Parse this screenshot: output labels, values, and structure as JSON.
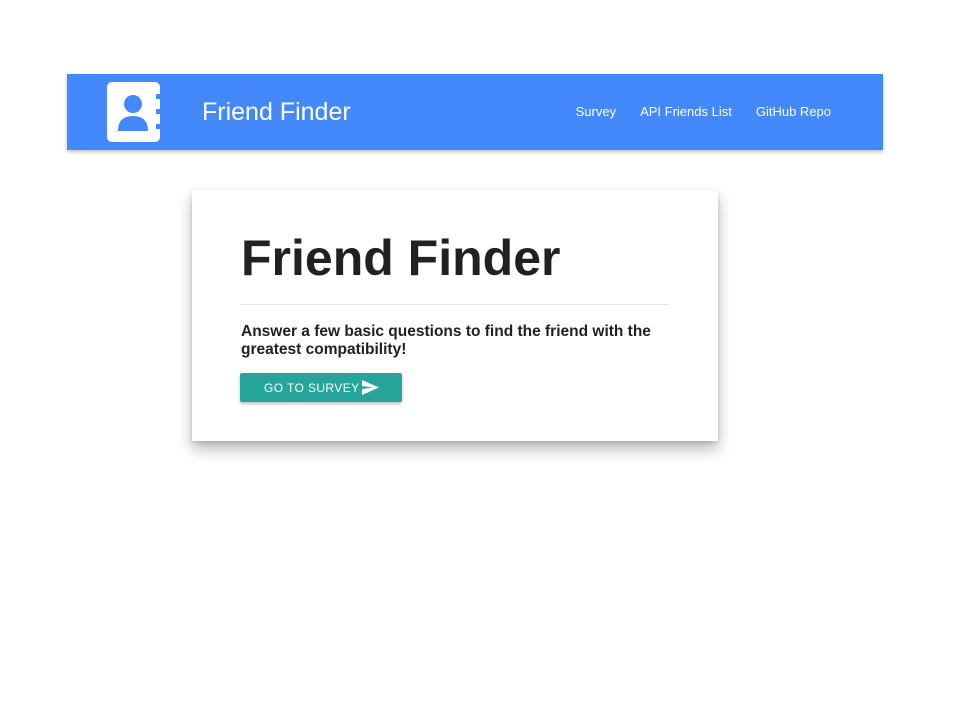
{
  "navbar": {
    "brand": "Friend Finder",
    "logo_icon": "contact-book-icon",
    "links": [
      {
        "label": "Survey"
      },
      {
        "label": "API Friends List"
      },
      {
        "label": "GitHub Repo"
      }
    ]
  },
  "card": {
    "title": "Friend Finder",
    "text": "Answer a few basic questions to find the friend with the greatest compatibility!",
    "button_label": "GO TO SURVEY",
    "button_icon": "send-icon"
  },
  "colors": {
    "navbar": "#4489fc",
    "button": "#26a69a",
    "text": "#212121"
  }
}
